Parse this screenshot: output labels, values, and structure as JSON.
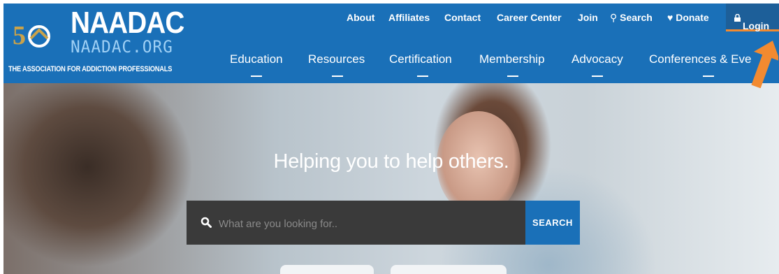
{
  "header": {
    "logo": {
      "brand": "NAADAC",
      "site": "NAADAC.ORG",
      "tagline": "THE ASSOCIATION FOR ADDICTION PROFESSIONALS",
      "badge_icon": "50th-anniversary-badge"
    },
    "utility_nav": [
      {
        "label": "About"
      },
      {
        "label": "Affiliates"
      },
      {
        "label": "Contact"
      },
      {
        "label": "Career Center"
      },
      {
        "label": "Join"
      },
      {
        "label": "Search",
        "icon": "search-icon"
      },
      {
        "label": "Donate",
        "icon": "heart-icon"
      }
    ],
    "login": {
      "label": "Login",
      "icon": "lock-icon"
    },
    "main_nav": [
      {
        "label": "Education"
      },
      {
        "label": "Resources"
      },
      {
        "label": "Certification"
      },
      {
        "label": "Membership"
      },
      {
        "label": "Advocacy"
      },
      {
        "label": "Conferences & Eve"
      }
    ]
  },
  "hero": {
    "headline": "Helping you to help others.",
    "search": {
      "placeholder": "What are you looking for..",
      "value": "",
      "button_label": "SEARCH"
    }
  },
  "colors": {
    "brand_blue": "#1a70b8",
    "login_bg": "#1d5f99",
    "accent_orange": "#f28a30",
    "search_bg": "#3a3a3a"
  }
}
